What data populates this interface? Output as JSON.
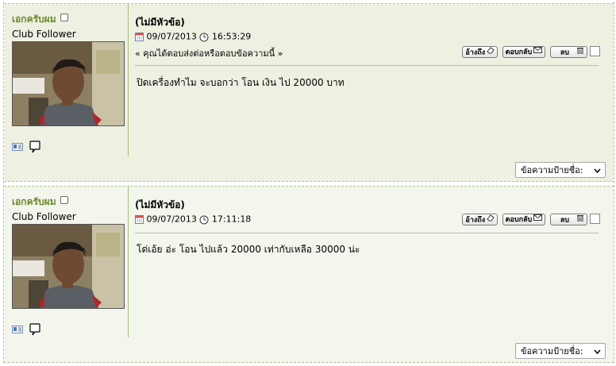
{
  "posts": [
    {
      "username": "เอกครับผม",
      "rank": "Club Follower",
      "subject": "(ไม่มีหัวข้อ)",
      "date": "09/07/2013",
      "time": "16:53:29",
      "nav_text": "« คุณได้ตอบส่งต่อหรือตอบข้อความนี้ »",
      "quote_label": "อ้างถึง",
      "reply_label": "ตอบกลับ",
      "delete_label": "ลบ",
      "message": "ปิดเครื่องทำไม จะบอกว่า โอน เงิน ไป 20000 บาท",
      "signature_select": "ข้อความป้ายชื่อ:"
    },
    {
      "username": "เอกครับผม",
      "rank": "Club Follower",
      "subject": "(ไม่มีหัวข้อ)",
      "date": "09/07/2013",
      "time": "17:11:18",
      "quote_label": "อ้างถึง",
      "reply_label": "ตอบกลับ",
      "delete_label": "ลบ",
      "message": "โด่เอ้ย อ่ะ โอน ไปแล้ว 20000 เท่ากับเหลือ 30000 น่ะ",
      "signature_select": "ข้อความป้ายชื่อ:"
    }
  ],
  "colors": {
    "odd_background": "#eef1e2",
    "even_background": "#f3f6ec",
    "username": "#6a8a2a",
    "divider": "#a3bf7a"
  },
  "icons": [
    "calendar-icon",
    "clock-icon",
    "profile-card-icon",
    "speech-bubble-icon",
    "eraser-icon",
    "envelope-icon",
    "trash-icon",
    "chevron-down-icon"
  ]
}
